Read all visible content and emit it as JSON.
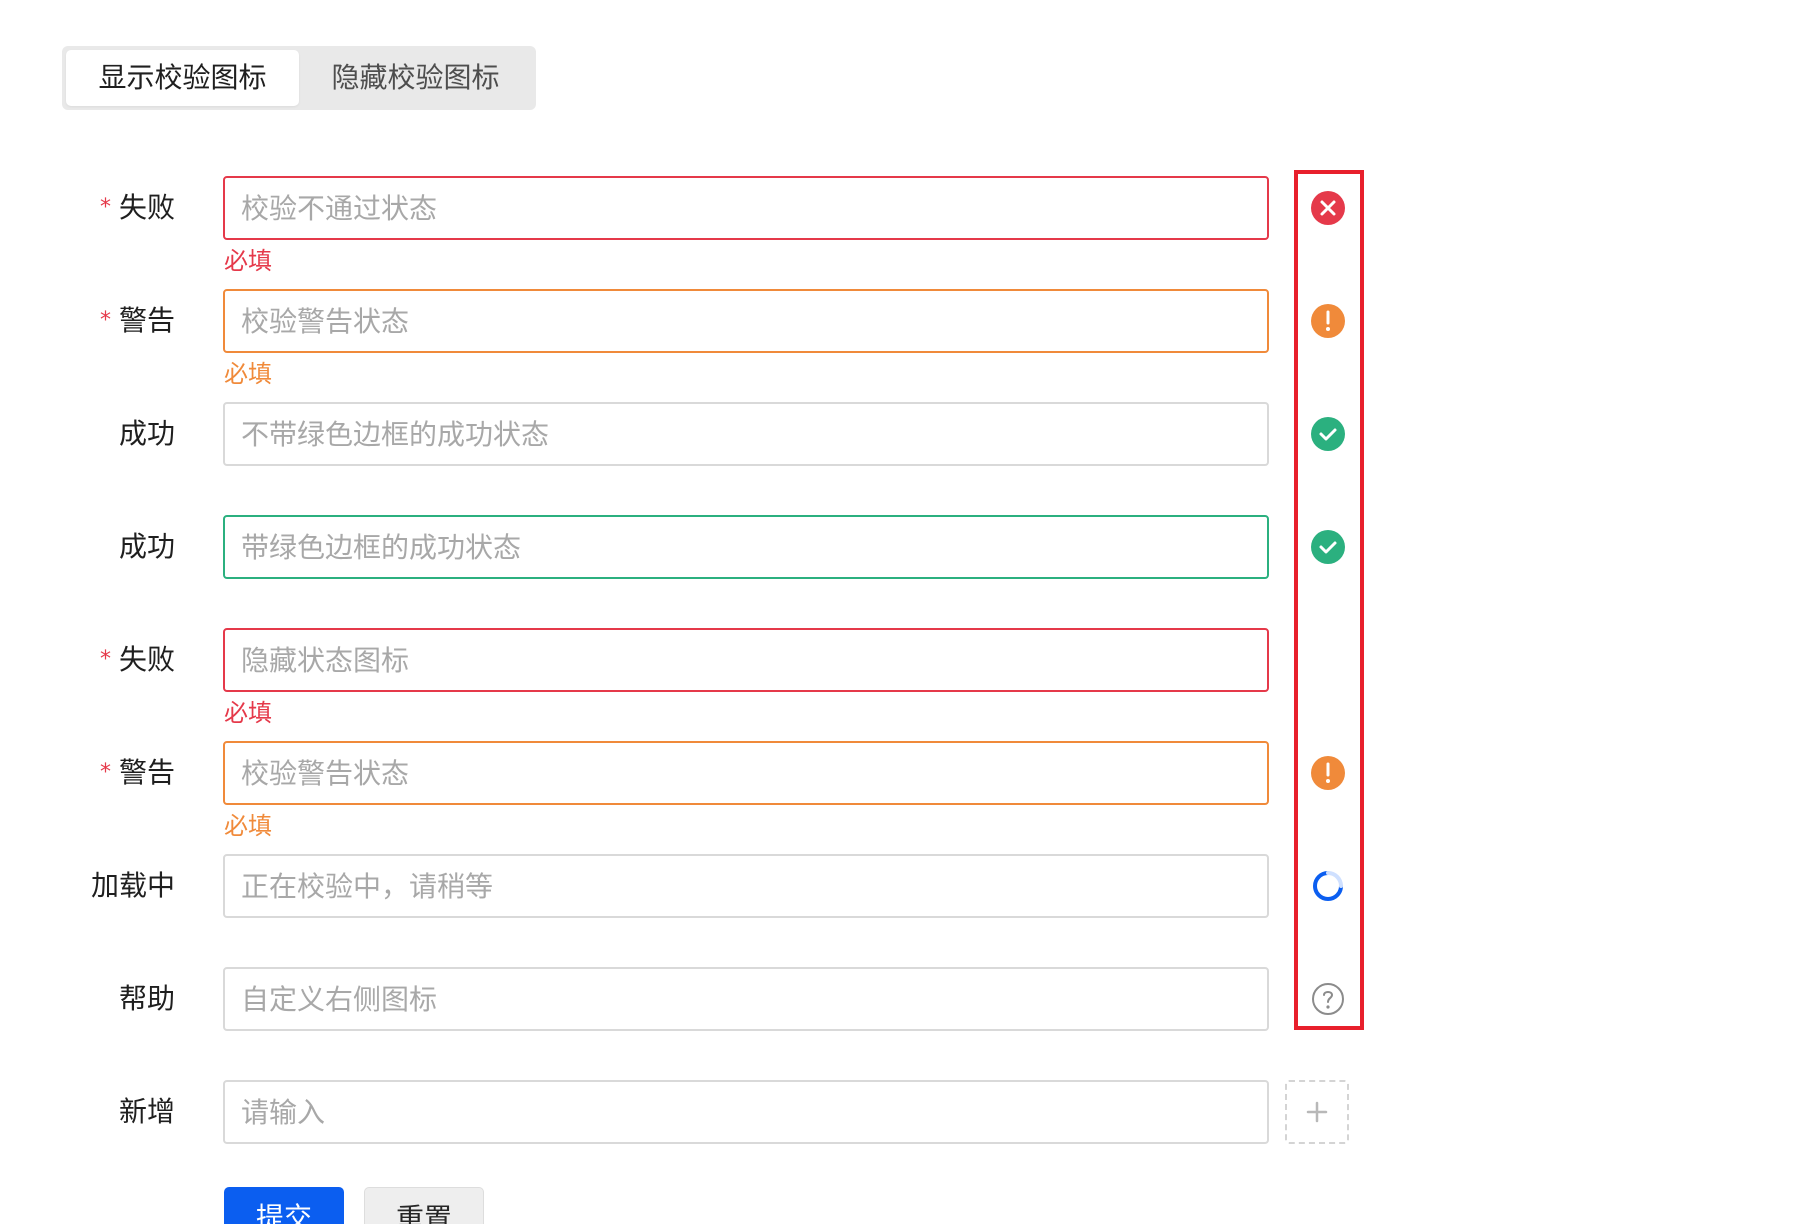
{
  "tabs": {
    "show_icons": "显示校验图标",
    "hide_icons": "隐藏校验图标",
    "active": "show_icons"
  },
  "rows": [
    {
      "label": "失败",
      "required": true,
      "placeholder": "校验不通过状态",
      "status": "error",
      "helper": "必填",
      "icon": "error-circle-icon"
    },
    {
      "label": "警告",
      "required": true,
      "placeholder": "校验警告状态",
      "status": "warning",
      "helper": "必填",
      "icon": "warning-circle-icon"
    },
    {
      "label": "成功",
      "required": false,
      "placeholder": "不带绿色边框的成功状态",
      "status": "success-no-border",
      "helper": "",
      "icon": "success-check-icon"
    },
    {
      "label": "成功",
      "required": false,
      "placeholder": "带绿色边框的成功状态",
      "status": "success",
      "helper": "",
      "icon": "success-check-icon"
    },
    {
      "label": "失败",
      "required": true,
      "placeholder": "隐藏状态图标",
      "status": "error",
      "helper": "必填",
      "icon": ""
    },
    {
      "label": "警告",
      "required": true,
      "placeholder": "校验警告状态",
      "status": "warning",
      "helper": "必填",
      "icon": "warning-circle-icon"
    },
    {
      "label": "加载中",
      "required": false,
      "placeholder": "正在校验中，请稍等",
      "status": "loading",
      "helper": "",
      "icon": "loading-spinner-icon"
    },
    {
      "label": "帮助",
      "required": false,
      "placeholder": "自定义右侧图标",
      "status": "help",
      "helper": "",
      "icon": "help-circle-icon"
    },
    {
      "label": "新增",
      "required": false,
      "placeholder": "请输入",
      "status": "default",
      "helper": "",
      "icon": "plus-icon"
    }
  ],
  "required_mark": "*",
  "buttons": {
    "submit": "提交",
    "reset": "重置"
  },
  "colors": {
    "error": "#e5394a",
    "warning": "#f08a3a",
    "success": "#2bb07f",
    "primary": "#0b5ef0",
    "highlight": "#e81f2c"
  }
}
